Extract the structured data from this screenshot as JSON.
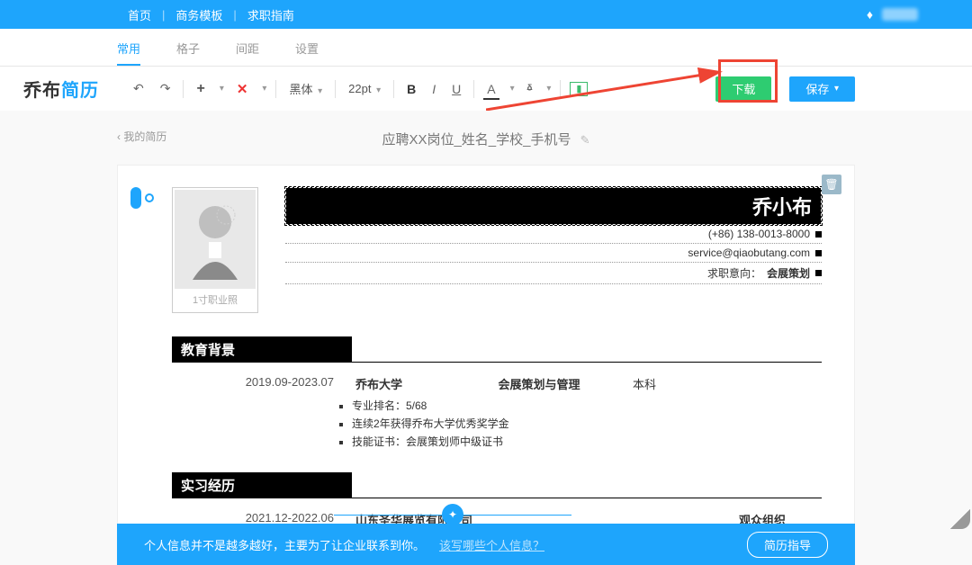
{
  "topnav": {
    "items": [
      "首页",
      "商务模板",
      "求职指南"
    ]
  },
  "subtabs": {
    "items": [
      "常用",
      "格子",
      "间距",
      "设置"
    ],
    "active_index": 0
  },
  "logo": {
    "a": "乔布",
    "b": "简历"
  },
  "toolbar": {
    "font_family": "黑体",
    "font_size": "22pt",
    "download": "下载",
    "save": "保存"
  },
  "breadcrumb": "我的简历",
  "doc_title": "应聘XX岗位_姓名_学校_手机号",
  "photo_caption": "1寸职业照",
  "profile": {
    "name": "乔小布",
    "phone": "(+86) 138-0013-8000",
    "email": "service@qiaobutang.com",
    "intent_label": "求职意向：",
    "intent_value": "会展策划"
  },
  "sections": {
    "edu_title": "教育背景",
    "edu": {
      "date": "2019.09-2023.07",
      "school": "乔布大学",
      "major": "会展策划与管理",
      "degree": "本科",
      "bullets": [
        "专业排名：5/68",
        "连续2年获得乔布大学优秀奖学金",
        "技能证书：会展策划师中级证书"
      ]
    },
    "intern_title": "实习经历",
    "intern": {
      "date": "2021.12-2022.06",
      "company": "山东圣华展览有限公司",
      "role": "观众组织"
    }
  },
  "footer": {
    "tip": "个人信息并不是越多越好，主要为了让企业联系到你。",
    "link": "该写哪些个人信息？",
    "guide": "简历指导"
  }
}
